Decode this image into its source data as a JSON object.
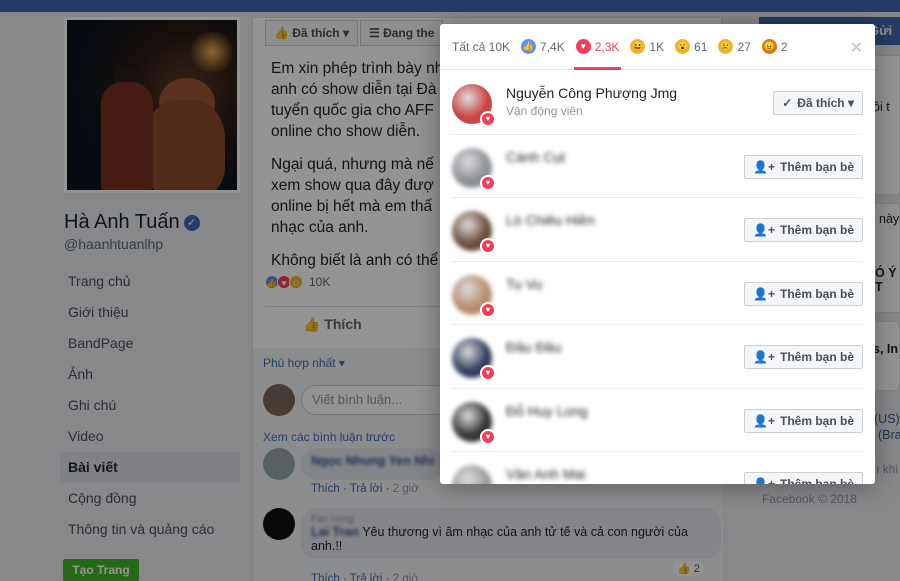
{
  "profile": {
    "name": "Hà Anh Tuấn",
    "handle": "@haanhtuanlhp",
    "nav": [
      "Trang chủ",
      "Giới thiệu",
      "BandPage",
      "Ảnh",
      "Ghi chú",
      "Video",
      "Bài viết",
      "Cộng đồng",
      "Thông tin và quảng cáo"
    ],
    "active_nav_index": 6,
    "create_page_label": "Tạo Trang"
  },
  "post": {
    "liked_label": "Đã thích",
    "following_label": "Đang the",
    "paragraphs": [
      "Em xin phép trình bày nh\nanh có show diễn tại Đà\ntuyển quốc gia cho AFF\nonline cho show diễn.",
      "Ngại quá, nhưng mà nế\nxem show qua đây đượ\nonline bị hết mà em thấ\nnhạc của anh.",
      "Không biết là anh có thể"
    ],
    "reaction_count": "10K",
    "like_action": "Thích",
    "sort_label": "Phù hợp nhất ▾",
    "comment_placeholder": "Viết bình luận...",
    "view_previous": "Xem các bình luận trước",
    "comments": [
      {
        "name": "Ngọc Nhung Yen Nhi",
        "text": "",
        "meta_like": "Thích",
        "meta_reply": "Trả lời",
        "time": "2 giờ",
        "count": ""
      },
      {
        "name": "Lai Tran",
        "tag": "Fan cứng",
        "text": "Yêu thương vì âm nhạc của anh tử tế và cả con người của anh.!!",
        "meta_like": "Thích",
        "meta_reply": "Trả lời",
        "time": "2 giờ",
        "count": "2"
      }
    ]
  },
  "right": {
    "send_button": "Gửi t",
    "lines": [
      "ồi t",
      "này",
      "Ó Ý T",
      "s, In",
      "(US)",
      "(Bra",
      "ı khi",
      "Facebook © 2018"
    ]
  },
  "dialog": {
    "tabs": [
      {
        "label": "Tất cả 10K",
        "icon": "",
        "color": ""
      },
      {
        "label": "7,4K",
        "icon": "like-icon",
        "color": "#5890ff"
      },
      {
        "label": "2,3K",
        "icon": "love-icon",
        "color": "#f33e58"
      },
      {
        "label": "1K",
        "icon": "haha-icon",
        "color": "#f7b125"
      },
      {
        "label": "61",
        "icon": "wow-icon",
        "color": "#f7b125"
      },
      {
        "label": "27",
        "icon": "sad-icon",
        "color": "#f7b125"
      },
      {
        "label": "2",
        "icon": "angry-icon",
        "color": "#e9710f"
      }
    ],
    "active_tab_index": 2,
    "people": [
      {
        "name": "Nguyễn Công Phượng Jmg",
        "role": "Vận động viên",
        "button": "Đã thích",
        "blurred": false,
        "avatar": "#c44"
      },
      {
        "name": "Cánh Cụt",
        "role": "",
        "button": "Thêm bạn bè",
        "blurred": true,
        "avatar": "#8a8d93"
      },
      {
        "name": "Lò Chiêu Hiền",
        "role": "",
        "button": "Thêm bạn bè",
        "blurred": true,
        "avatar": "#6b4a3a"
      },
      {
        "name": "Tu Vu",
        "role": "",
        "button": "Thêm bạn bè",
        "blurred": true,
        "avatar": "#b58a6a"
      },
      {
        "name": "Đầu Đầu",
        "role": "",
        "button": "Thêm bạn bè",
        "blurred": true,
        "avatar": "#2f3b5c"
      },
      {
        "name": "Đỗ Huy Long",
        "role": "",
        "button": "Thêm bạn bè",
        "blurred": true,
        "avatar": "#333"
      },
      {
        "name": "Văn Anh Mai",
        "role": "",
        "button": "Thêm bạn bè",
        "blurred": true,
        "avatar": "#999"
      }
    ]
  }
}
